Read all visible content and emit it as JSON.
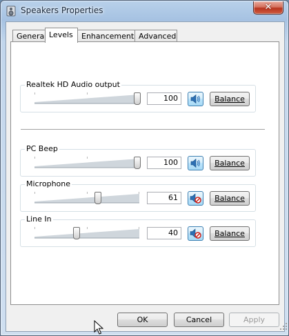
{
  "window": {
    "title": "Speakers Properties",
    "close_label": "✕"
  },
  "tabs": [
    {
      "label": "General",
      "active": false
    },
    {
      "label": "Levels",
      "active": true
    },
    {
      "label": "Enhancements",
      "active": false
    },
    {
      "label": "Advanced",
      "active": false
    }
  ],
  "levels": [
    {
      "name": "Realtek HD Audio output",
      "value": "100",
      "level": 100,
      "muted": false,
      "balance_label": "Balance"
    },
    {
      "name": "PC Beep",
      "value": "100",
      "level": 100,
      "muted": false,
      "balance_label": "Balance"
    },
    {
      "name": "Microphone",
      "value": "61",
      "level": 61,
      "muted": true,
      "balance_label": "Balance"
    },
    {
      "name": "Line In",
      "value": "40",
      "level": 40,
      "muted": true,
      "balance_label": "Balance"
    }
  ],
  "buttons": {
    "ok": "OK",
    "cancel": "Cancel",
    "apply": "Apply"
  }
}
